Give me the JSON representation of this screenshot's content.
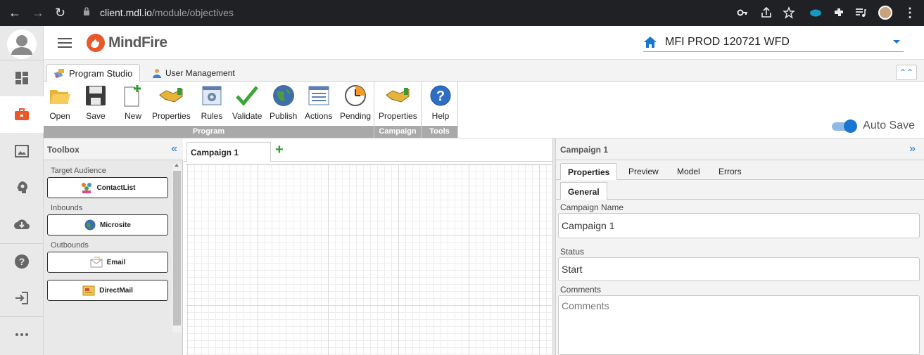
{
  "browser": {
    "url_host": "client.mdl.io",
    "url_path": "/module/objectives"
  },
  "header": {
    "logo_text": "MindFire",
    "org_name": "MFI PROD 120721 WFD"
  },
  "module_tabs": [
    {
      "label": "Program Studio",
      "active": true
    },
    {
      "label": "User Management",
      "active": false
    }
  ],
  "ribbon": {
    "groups": [
      {
        "name": "Program",
        "buttons": [
          "Open",
          "Save",
          "New",
          "Properties",
          "Rules",
          "Validate",
          "Publish",
          "Actions",
          "Pending"
        ]
      },
      {
        "name": "Campaign",
        "buttons": [
          "Properties"
        ]
      },
      {
        "name": "Tools",
        "buttons": [
          "Help"
        ]
      }
    ],
    "autosave_label": "Auto Save",
    "autosave_on": true
  },
  "toolbox": {
    "title": "Toolbox",
    "sections": [
      {
        "label": "Target Audience",
        "items": [
          "ContactList"
        ]
      },
      {
        "label": "Inbounds",
        "items": [
          "Microsite"
        ]
      },
      {
        "label": "Outbounds",
        "items": [
          "Email",
          "DirectMail"
        ]
      }
    ]
  },
  "canvas": {
    "tab_label": "Campaign 1"
  },
  "properties_panel": {
    "title": "Campaign 1",
    "tabs": [
      "Properties",
      "Preview",
      "Model",
      "Errors"
    ],
    "subtab": "General",
    "fields": {
      "campaign_name_label": "Campaign Name",
      "campaign_name_value": "Campaign 1",
      "status_label": "Status",
      "status_value": "Start",
      "comments_label": "Comments",
      "comments_placeholder": "Comments"
    }
  },
  "colors": {
    "accent": "#1976d2",
    "group_bar": "#a9a9a9",
    "rail_bg": "#e9e9e9",
    "active_rail_icon": "#e8582a"
  },
  "icons": {
    "rail": [
      "dashboard-icon",
      "briefcase-icon",
      "image-gallery-icon",
      "brain-icon",
      "cloud-download-icon",
      "help-icon",
      "logout-icon",
      "more-icon"
    ]
  }
}
